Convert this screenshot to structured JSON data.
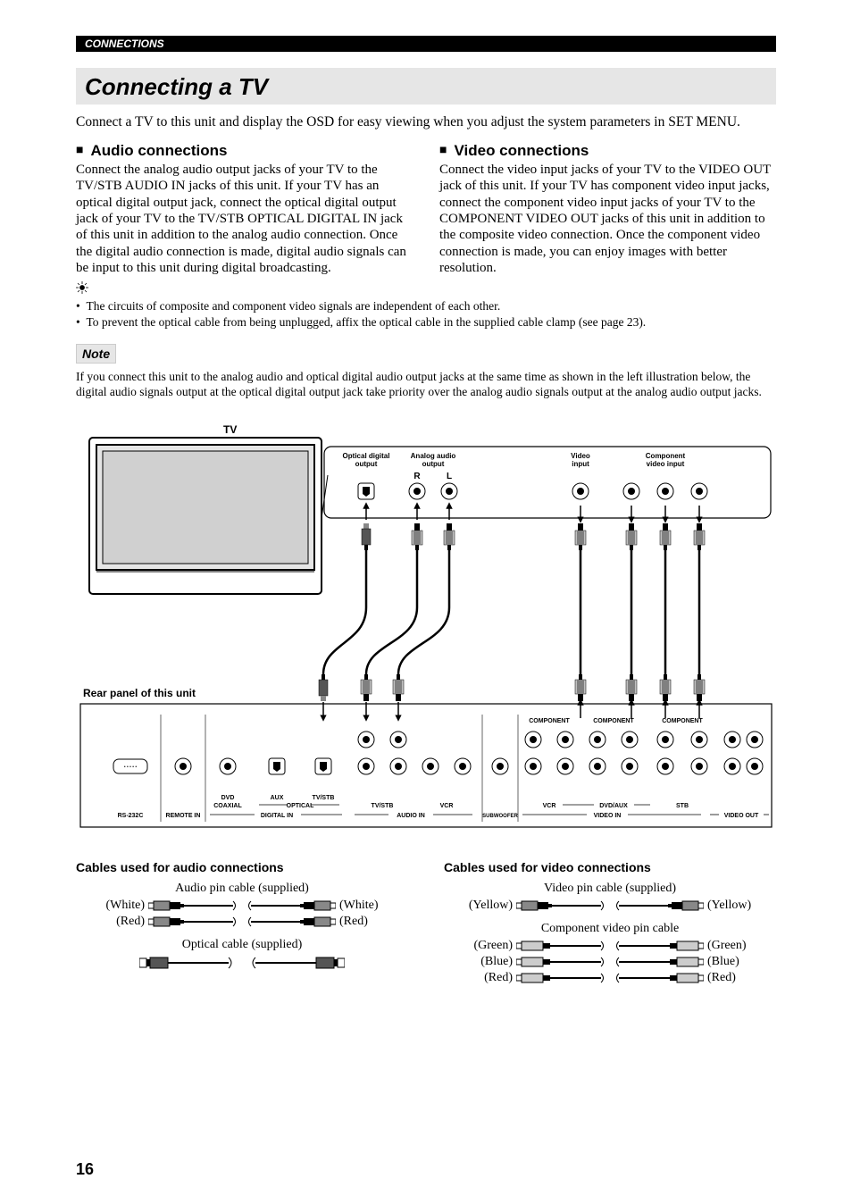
{
  "header": {
    "section": "CONNECTIONS"
  },
  "title": "Connecting a TV",
  "intro": "Connect a TV to this unit and display the OSD for easy viewing when you adjust the system parameters in SET MENU.",
  "cols": {
    "audio": {
      "heading": "Audio connections",
      "body": "Connect the analog audio output jacks of your TV to the TV/STB AUDIO IN jacks of this unit. If your TV has an optical digital output jack, connect the optical digital output jack of your TV to the TV/STB OPTICAL DIGITAL IN jack of this unit in addition to the analog audio connection. Once the digital audio connection is made, digital audio signals can be input to this unit during digital broadcasting."
    },
    "video": {
      "heading": "Video connections",
      "body": "Connect the video input jacks of your TV to the VIDEO OUT jack of this unit. If your TV has component video input jacks, connect the component video input jacks of your TV to the COMPONENT VIDEO OUT jacks of this unit in addition to the composite video connection. Once the component video connection is made, you can enjoy images with better resolution."
    }
  },
  "tips": {
    "b1": "The circuits of composite and component video signals are independent of each other.",
    "b2": "To prevent the optical cable from being unplugged, affix the optical cable in the supplied cable clamp (see page 23)."
  },
  "note": {
    "label": "Note",
    "text": "If you connect this unit to the analog audio and optical digital audio output jacks at the same time as shown in the left illustration below, the digital audio signals output at the optical digital output jack take priority over the analog audio signals output at the analog audio output jacks."
  },
  "diagram": {
    "tv_label": "TV",
    "tv_opt": "Optical digital output",
    "tv_analog": "Analog audio output",
    "tv_video": "Video input",
    "tv_comp": "Component video input",
    "r": "R",
    "l": "L",
    "rear": "Rear panel of this unit",
    "comp_a": "COMPONENT",
    "comp_b": "COMPONENT",
    "comp_c": "COMPONENT",
    "rs": "RS-232C",
    "remote": "REMOTE IN",
    "dvd_coax": "DVD COAXIAL",
    "aux": "AUX",
    "tvstb": "TV/STB",
    "optical": "OPTICAL",
    "digital_in": "DIGITAL IN",
    "audio_in_tvstb": "TV/STB",
    "audio_in_vcr": "VCR",
    "audio_in": "AUDIO IN",
    "sub": "SUBWOOFER",
    "vcr": "VCR",
    "dvdaux": "DVD/AUX",
    "stb": "STB",
    "video_in": "VIDEO IN",
    "video_out": "VIDEO OUT"
  },
  "cables": {
    "audio_h": "Cables used for audio connections",
    "video_h": "Cables used for video connections",
    "audio_pin": "Audio pin cable (supplied)",
    "white": "(White)",
    "red": "(Red)",
    "optical": "Optical cable (supplied)",
    "video_pin": "Video pin cable (supplied)",
    "yellow": "(Yellow)",
    "component": "Component video pin cable",
    "green": "(Green)",
    "blue": "(Blue)"
  },
  "page": "16"
}
